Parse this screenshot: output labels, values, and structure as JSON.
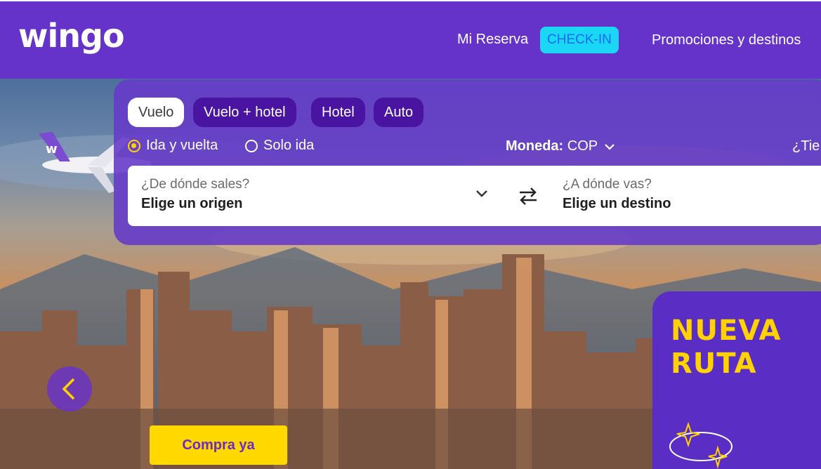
{
  "brand": {
    "logo_text": "wingo",
    "primary": "#6533c9",
    "accent_yellow": "#ffd200",
    "accent_cyan": "#19d7f5"
  },
  "nav": {
    "items": [
      {
        "label": "Mi Reserva"
      },
      {
        "label": "CHECK-IN"
      },
      {
        "label": "Promociones y destinos"
      }
    ]
  },
  "search": {
    "tabs": [
      {
        "label": "Vuelo",
        "active": true
      },
      {
        "label": "Vuelo + hotel",
        "active": false
      },
      {
        "label": "Hotel",
        "active": false
      },
      {
        "label": "Auto",
        "active": false
      }
    ],
    "trip_types": [
      {
        "label": "Ida y vuelta",
        "selected": true
      },
      {
        "label": "Solo ida",
        "selected": false
      }
    ],
    "currency_label": "Moneda:",
    "currency_value": "COP",
    "promo_code_prompt": "¿Tie",
    "origin": {
      "label": "¿De dónde sales?",
      "value": "Elige un origen"
    },
    "destination": {
      "label": "¿A dónde vas?",
      "value": "Elige un destino"
    }
  },
  "hero": {
    "cta_label": "Compra ya",
    "promo_title_line1": "NUEVA",
    "promo_title_line2": "RUTA"
  },
  "icons": [
    "chevron-down-icon",
    "swap-arrows-icon",
    "chevron-left-icon",
    "airplane-image",
    "route-globe-icon"
  ]
}
